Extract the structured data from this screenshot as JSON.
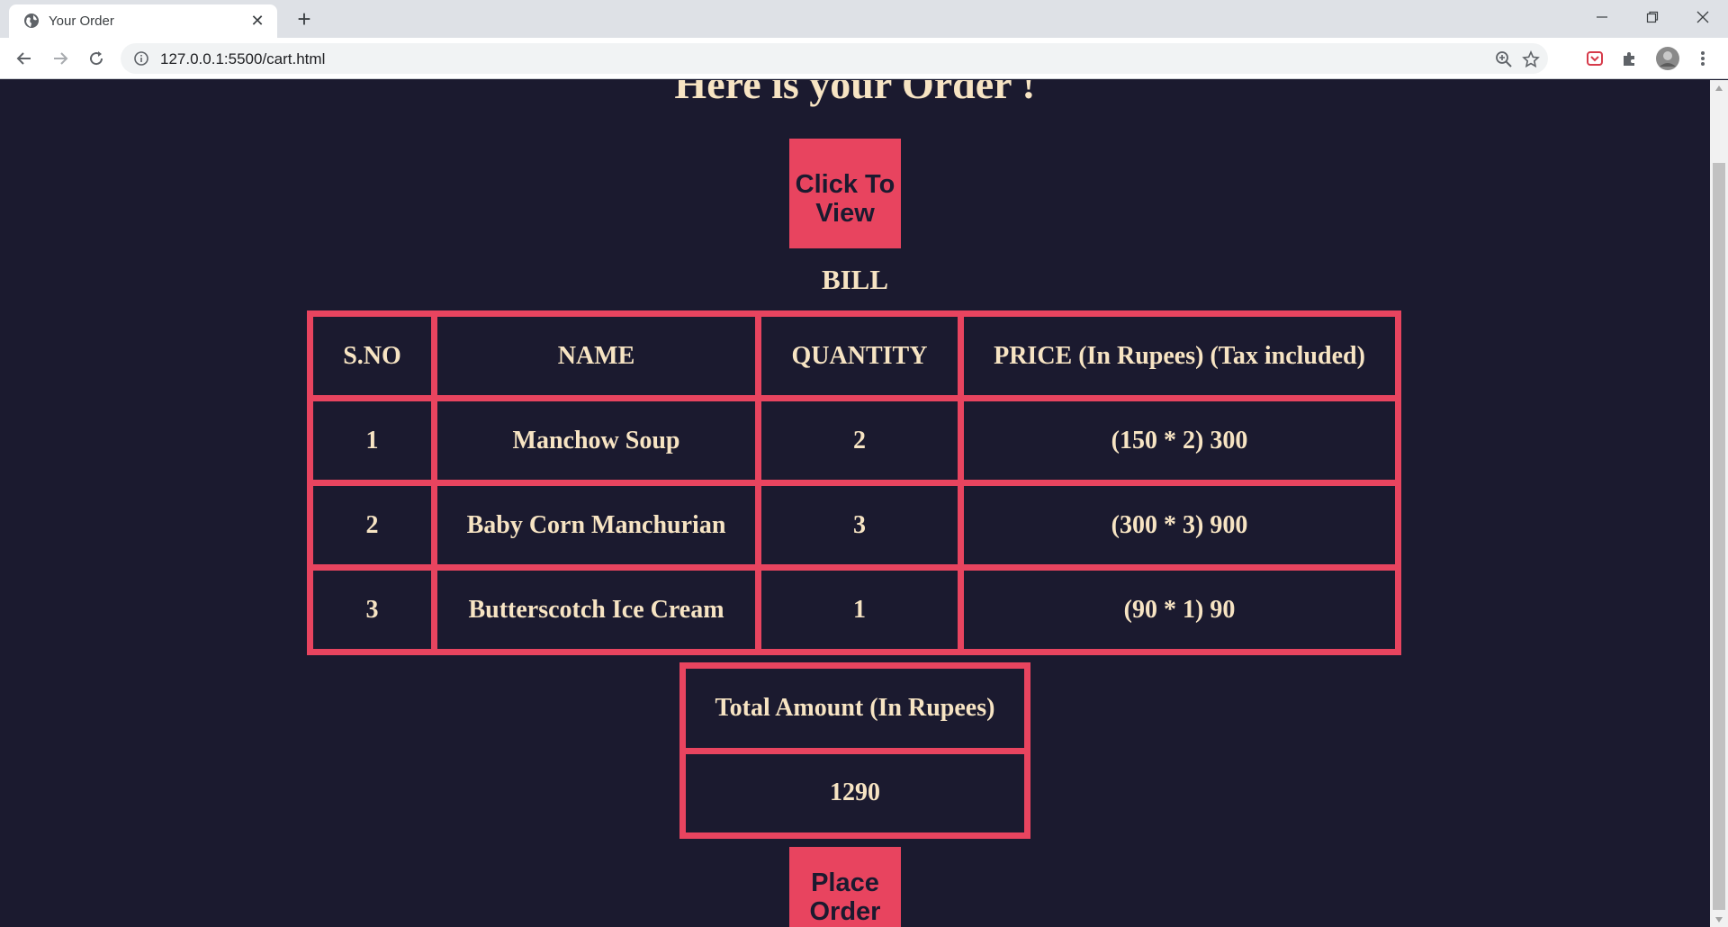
{
  "browser": {
    "tab_title": "Your Order",
    "url": "127.0.0.1:5500/cart.html"
  },
  "page": {
    "heading": "Here is your Order !",
    "view_button": "Click To View",
    "bill_label": "BILL",
    "columns": [
      "S.NO",
      "NAME",
      "QUANTITY",
      "PRICE (In Rupees) (Tax included)"
    ],
    "rows": [
      {
        "sno": "1",
        "name": "Manchow Soup",
        "qty": "2",
        "price": "(150 * 2) 300"
      },
      {
        "sno": "2",
        "name": "Baby Corn Manchurian",
        "qty": "3",
        "price": "(300 * 3) 900"
      },
      {
        "sno": "3",
        "name": "Butterscotch Ice Cream",
        "qty": "1",
        "price": "(90 * 1) 90"
      }
    ],
    "total_label": "Total Amount (In Rupees)",
    "total_value": "1290",
    "place_order_button": "Place Order"
  },
  "colors": {
    "background": "#1b1a2f",
    "accent": "#e8445f",
    "text": "#f7e4c3"
  }
}
